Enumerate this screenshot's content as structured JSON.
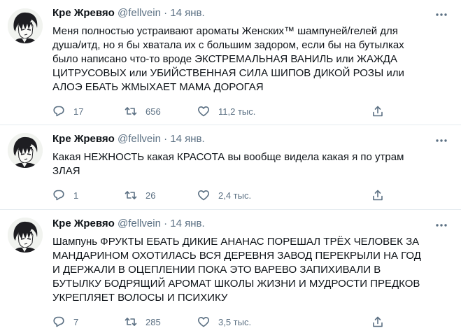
{
  "tweets": [
    {
      "author_name": "Кре Жревяо",
      "handle": "@fellvein",
      "separator": "·",
      "date": "14 янв.",
      "text": "Меня полностью устраивают ароматы Женских™ шампуней/гелей для\nдуша/итд, но я бы хватала их с большим задором, если бы на бутылках\nбыло написано что-то вроде ЭКСТРЕМАЛЬНАЯ ВАНИЛЬ или ЖАЖДА\nЦИТРУСОВЫХ или УБИЙСТВЕННАЯ СИЛА ШИПОВ ДИКОЙ РОЗЫ или\nАЛОЭ ЕБАТЬ ЖМЫХАЕТ МАМА ДОРОГАЯ",
      "replies": "17",
      "retweets": "656",
      "likes": "11,2 тыс."
    },
    {
      "author_name": "Кре Жревяо",
      "handle": "@fellvein",
      "separator": "·",
      "date": "14 янв.",
      "text": "Какая НЕЖНОСТЬ какая КРАСОТА вы вообще видела какая я по утрам\nЗЛАЯ",
      "replies": "1",
      "retweets": "26",
      "likes": "2,4 тыс."
    },
    {
      "author_name": "Кре Жревяо",
      "handle": "@fellvein",
      "separator": "·",
      "date": "14 янв.",
      "text": "Шампунь ФРУКТЫ ЕБАТЬ ДИКИЕ АНАНАС ПОРЕШАЛ ТРЁХ ЧЕЛОВЕК ЗА\nМАНДАРИНОМ ОХОТИЛАСЬ ВСЯ ДЕРЕВНЯ ЗАВОД ПЕРЕКРЫЛИ НА ГОД\nИ ДЕРЖАЛИ В ОЦЕПЛЕНИИ ПОКА ЭТО ВАРЕВО ЗАПИХИВАЛИ В\nБУТЫЛКУ БОДРЯЩИЙ АРОМАТ ШКОЛЫ ЖИЗНИ И МУДРОСТИ ПРЕДКОВ\nУКРЕПЛЯЕТ ВОЛОСЫ И ПСИХИКУ",
      "replies": "7",
      "retweets": "285",
      "likes": "3,5 тыс."
    }
  ],
  "colors": {
    "text": "#0f1419",
    "secondary": "#5b7083",
    "divider": "#e6ecf0"
  },
  "icons": [
    "avatar",
    "more-icon",
    "reply-icon",
    "retweet-icon",
    "like-icon",
    "share-icon"
  ]
}
